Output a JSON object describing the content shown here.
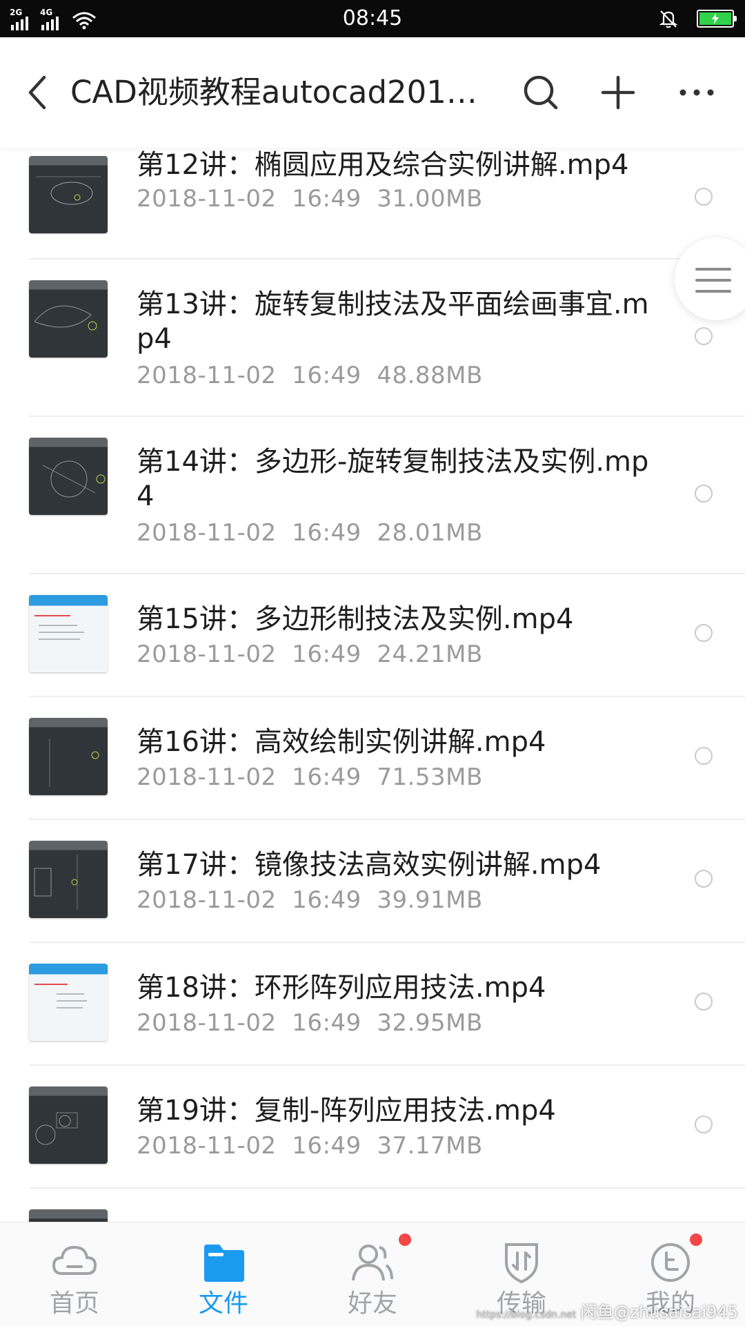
{
  "status_bar": {
    "time": "08:45",
    "signal_1": "2G",
    "signal_2": "4G",
    "icons": [
      "signal-2g-icon",
      "signal-4g-icon",
      "wifi-icon",
      "notification-muted-icon",
      "battery-charging-icon"
    ]
  },
  "header": {
    "title": "CAD视频教程autocad2018…",
    "back_icon": "chevron-left-icon",
    "actions": [
      "search-icon",
      "plus-icon",
      "more-icon"
    ]
  },
  "files": [
    {
      "name": "第12讲：椭圆应用及综合实例讲解.mp4",
      "date": "2018-11-02",
      "time": "16:49",
      "size": "31.00MB",
      "thumb": "dark"
    },
    {
      "name": "第13讲：旋转复制技法及平面绘画事宜.mp4",
      "date": "2018-11-02",
      "time": "16:49",
      "size": "48.88MB",
      "thumb": "dark"
    },
    {
      "name": "第14讲：多边形-旋转复制技法及实例.mp4",
      "date": "2018-11-02",
      "time": "16:49",
      "size": "28.01MB",
      "thumb": "dark"
    },
    {
      "name": "第15讲：多边形制技法及实例.mp4",
      "date": "2018-11-02",
      "time": "16:49",
      "size": "24.21MB",
      "thumb": "light"
    },
    {
      "name": "第16讲：高效绘制实例讲解.mp4",
      "date": "2018-11-02",
      "time": "16:49",
      "size": "71.53MB",
      "thumb": "dark"
    },
    {
      "name": "第17讲：镜像技法高效实例讲解.mp4",
      "date": "2018-11-02",
      "time": "16:49",
      "size": "39.91MB",
      "thumb": "dark"
    },
    {
      "name": "第18讲：环形阵列应用技法.mp4",
      "date": "2018-11-02",
      "time": "16:49",
      "size": "32.95MB",
      "thumb": "light"
    },
    {
      "name": "第19讲：复制-阵列应用技法.mp4",
      "date": "2018-11-02",
      "time": "16:49",
      "size": "37.17MB",
      "thumb": "dark"
    }
  ],
  "tabs": [
    {
      "label": "首页",
      "icon": "cloud-icon",
      "active": false,
      "badge": false
    },
    {
      "label": "文件",
      "icon": "folder-icon",
      "active": true,
      "badge": false
    },
    {
      "label": "好友",
      "icon": "friends-icon",
      "active": false,
      "badge": true
    },
    {
      "label": "传输",
      "icon": "transfer-icon",
      "active": false,
      "badge": false
    },
    {
      "label": "我的",
      "icon": "profile-icon",
      "active": false,
      "badge": true
    }
  ],
  "watermark": {
    "url": "https://blog.csdn.net",
    "text": "闲鱼@zhusaisai945"
  },
  "colors": {
    "accent": "#1a9bf0",
    "badge": "#f24747",
    "meta_text": "#9a9a9a",
    "inactive_tab": "#a0a4a8"
  }
}
